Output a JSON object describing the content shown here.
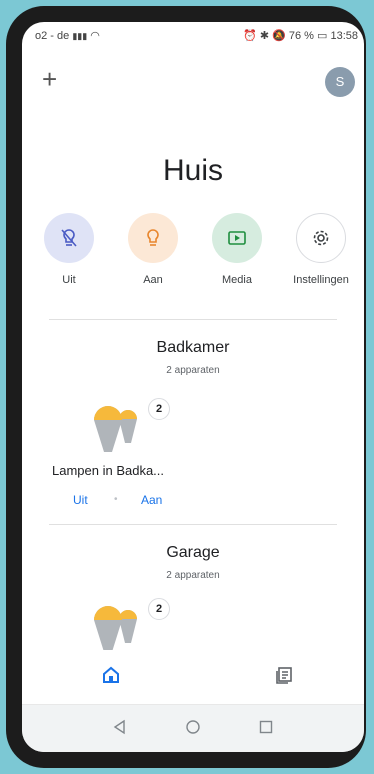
{
  "status": {
    "carrier": "o2 - de",
    "right_text": "76 %",
    "time": "13:58"
  },
  "header": {
    "add_label": "+",
    "avatar_initial": "S"
  },
  "home": {
    "title": "Huis"
  },
  "actions": [
    {
      "label": "Uit",
      "icon": "bulb-off-icon",
      "color": "#dfe3f6"
    },
    {
      "label": "Aan",
      "icon": "bulb-on-icon",
      "color": "#fce8d6"
    },
    {
      "label": "Media",
      "icon": "media-icon",
      "color": "#d6ecdf"
    },
    {
      "label": "Instellingen",
      "icon": "gear-icon",
      "color": "#ffffff"
    }
  ],
  "rooms": [
    {
      "name": "Badkamer",
      "count": "2 apparaten",
      "badge": "2",
      "device_name": "Lampen in Badka...",
      "off_label": "Uit",
      "on_label": "Aan"
    },
    {
      "name": "Garage",
      "count": "2 apparaten",
      "badge": "2"
    }
  ],
  "colors": {
    "accent": "#1a73e8",
    "bulb_top": "#f6b93b",
    "bulb_body": "#b0b5ba"
  }
}
